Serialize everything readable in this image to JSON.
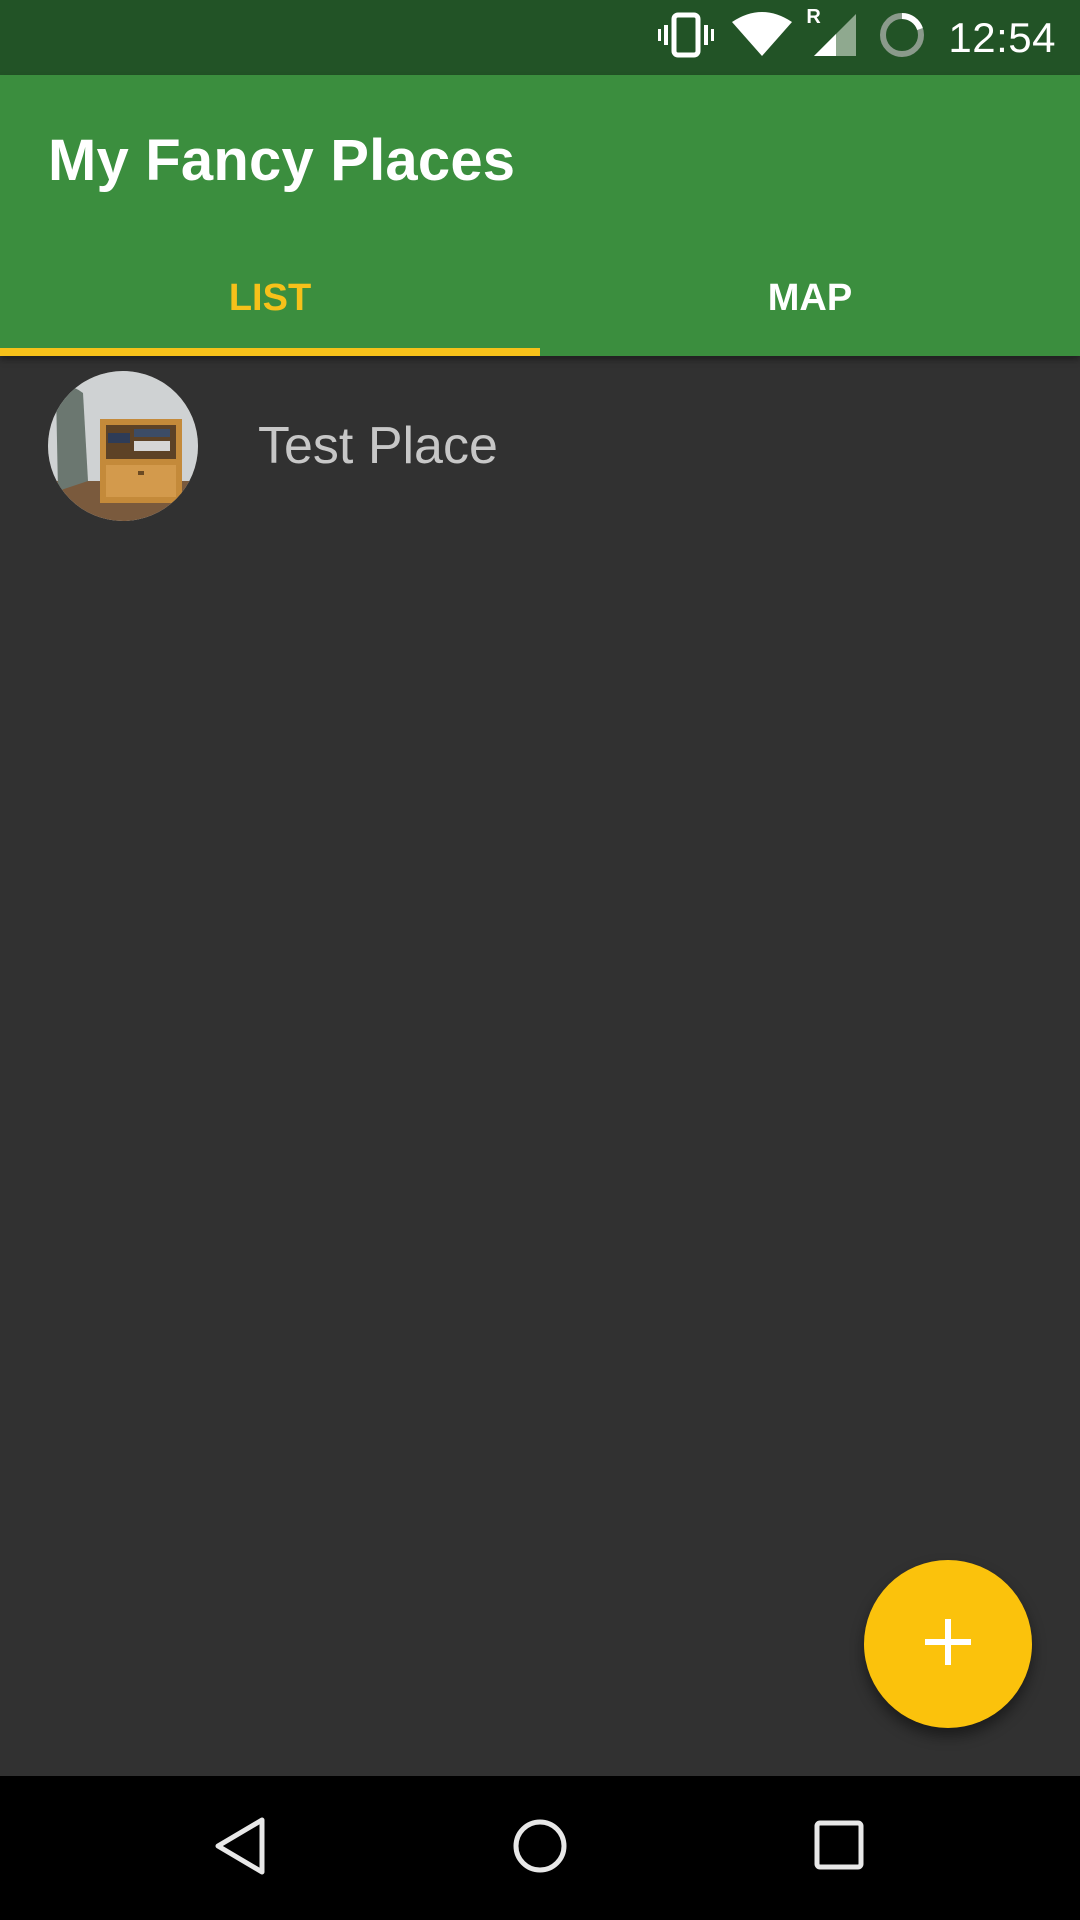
{
  "status_bar": {
    "time": "12:54",
    "icons": [
      "vibrate-icon",
      "wifi-icon",
      "signal-roaming-icon",
      "battery-charging-icon"
    ],
    "roaming_label": "R"
  },
  "app_bar": {
    "title": "My Fancy Places",
    "background": "#3b8e3e"
  },
  "tabs": [
    {
      "label": "LIST",
      "active": true
    },
    {
      "label": "MAP",
      "active": false
    }
  ],
  "accent_color": "#f6c11a",
  "places": [
    {
      "name": "Test Place",
      "thumbnail": "place-photo"
    }
  ],
  "fab": {
    "icon": "plus-icon",
    "color": "#fbc20c"
  },
  "nav_bar": {
    "buttons": [
      "back-icon",
      "home-icon",
      "recents-icon"
    ]
  }
}
